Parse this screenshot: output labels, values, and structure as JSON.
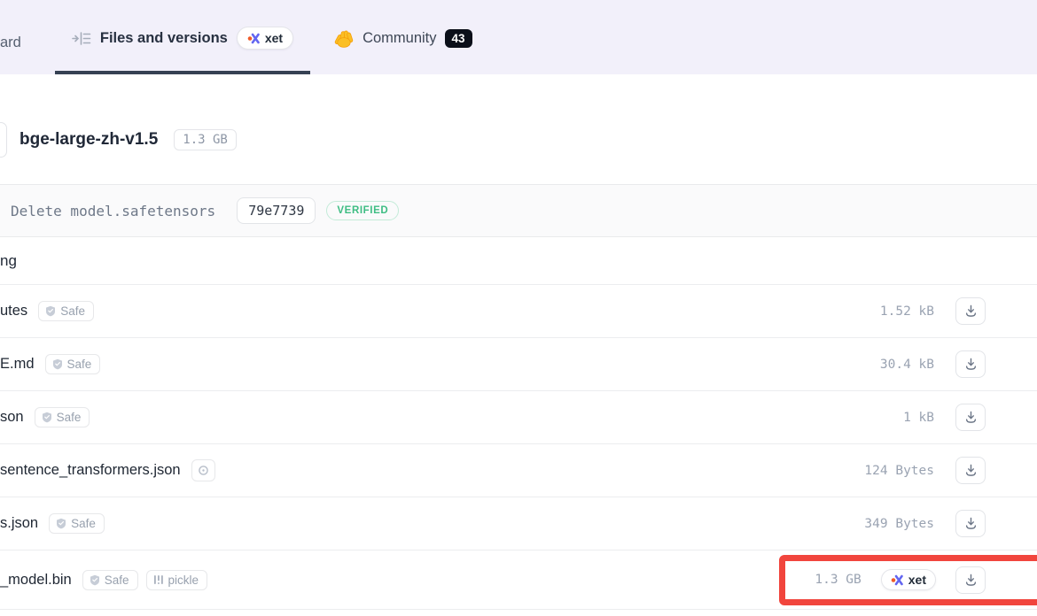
{
  "tabs": {
    "model_card_partial": "ard",
    "files_label": "Files and versions",
    "community_label": "Community",
    "community_count": "43"
  },
  "labels": {
    "safe": "Safe",
    "pickle": "pickle",
    "xet": "xet"
  },
  "repo": {
    "name": "bge-large-zh-v1.5",
    "total_size": "1.3 GB"
  },
  "commit": {
    "message": "Delete model.safetensors",
    "hash": "79e7739",
    "status": "VERIFIED"
  },
  "folder": {
    "name_partial": "ng"
  },
  "files": [
    {
      "name": "utes",
      "size": "1.52 kB"
    },
    {
      "name": "E.md",
      "size": "30.4 kB"
    },
    {
      "name": "son",
      "size": "1 kB"
    },
    {
      "name": "sentence_transformers.json",
      "size": "124 Bytes"
    },
    {
      "name": "s.json",
      "size": "349 Bytes"
    },
    {
      "name": "_model.bin",
      "size": "1.3 GB"
    }
  ],
  "colors": {
    "header_bg": "#f2f0fa",
    "active_tab_underline": "#364153",
    "verified_green": "#3ebd83",
    "annotation_red": "#f1453d",
    "xet_indigo": "#6366f1",
    "xet_orange": "#f05a28"
  }
}
